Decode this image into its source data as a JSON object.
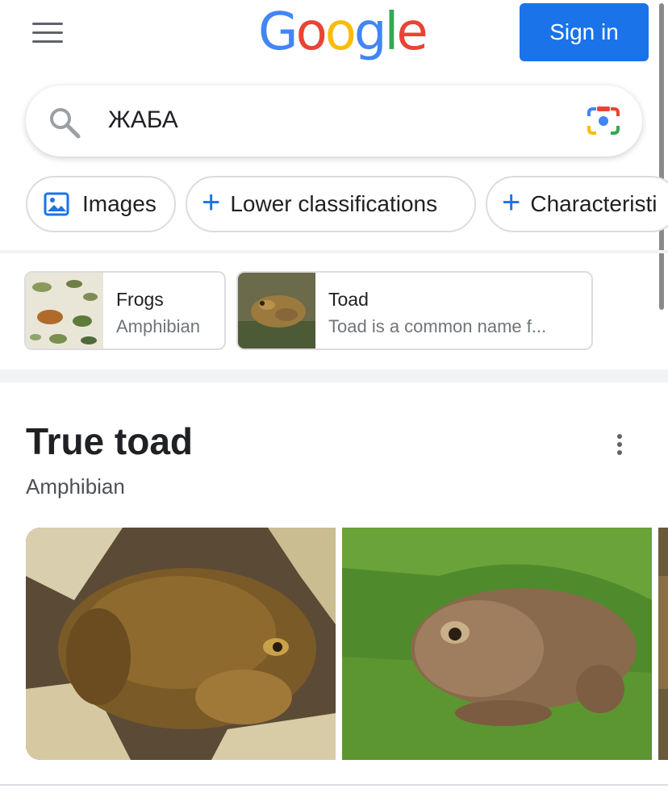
{
  "header": {
    "logo_letters": [
      {
        "ch": "G",
        "color": "#4285F4"
      },
      {
        "ch": "o",
        "color": "#EA4335"
      },
      {
        "ch": "o",
        "color": "#FBBC05"
      },
      {
        "ch": "g",
        "color": "#4285F4"
      },
      {
        "ch": "l",
        "color": "#34A853"
      },
      {
        "ch": "e",
        "color": "#EA4335"
      }
    ],
    "sign_in_label": "Sign in"
  },
  "search": {
    "query": "ЖАБА"
  },
  "chips": [
    {
      "label": "Images",
      "icon": "image-icon"
    },
    {
      "label": "Lower classifications",
      "icon": "plus-icon"
    },
    {
      "label": "Characteristi",
      "icon": "plus-icon"
    }
  ],
  "suggestions": [
    {
      "title": "Frogs",
      "subtitle": "Amphibian"
    },
    {
      "title": "Toad",
      "subtitle": "Toad is a common name f..."
    }
  ],
  "knowledge_panel": {
    "title": "True toad",
    "subtitle": "Amphibian"
  },
  "colors": {
    "accent": "#1a73e8",
    "chip_border": "#dadce0",
    "text_secondary": "#70757a"
  }
}
